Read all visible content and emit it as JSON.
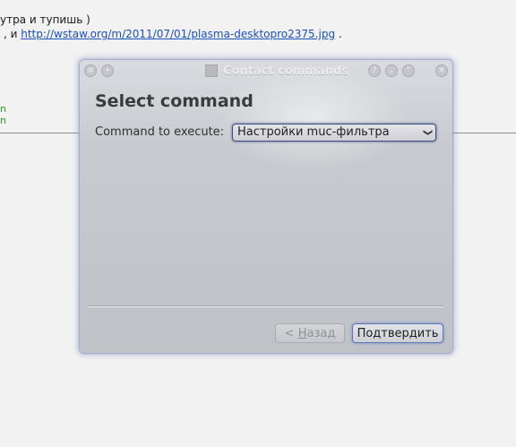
{
  "background": {
    "line1": "утра и тупишь )",
    "line2_prefix": ", и ",
    "line2_link": "http://wstaw.org/m/2011/07/01/plasma-desktopro2375.jpg",
    "line2_suffix": " .",
    "green_a": "n",
    "green_b": "n"
  },
  "dialog": {
    "title": "Contact commands",
    "heading": "Select command",
    "command_label": "Command to execute:",
    "command_value": "Настройки muc-фильтра",
    "back_prefix": "< ",
    "back_mnemonic": "Н",
    "back_rest": "азад",
    "confirm_label": "Подтвердить"
  },
  "colors": {
    "link": "#1d4fbf",
    "green_text": "#2a9a2a",
    "focus_ring": "#5e77b5"
  },
  "icons": {
    "menu": "menu-icon",
    "sticky": "pin-icon",
    "help": "help-icon",
    "minimize": "minimize-icon",
    "maximize": "maximize-icon",
    "close": "close-icon",
    "app": "app-icon",
    "dropdown": "chevron-down-icon"
  }
}
